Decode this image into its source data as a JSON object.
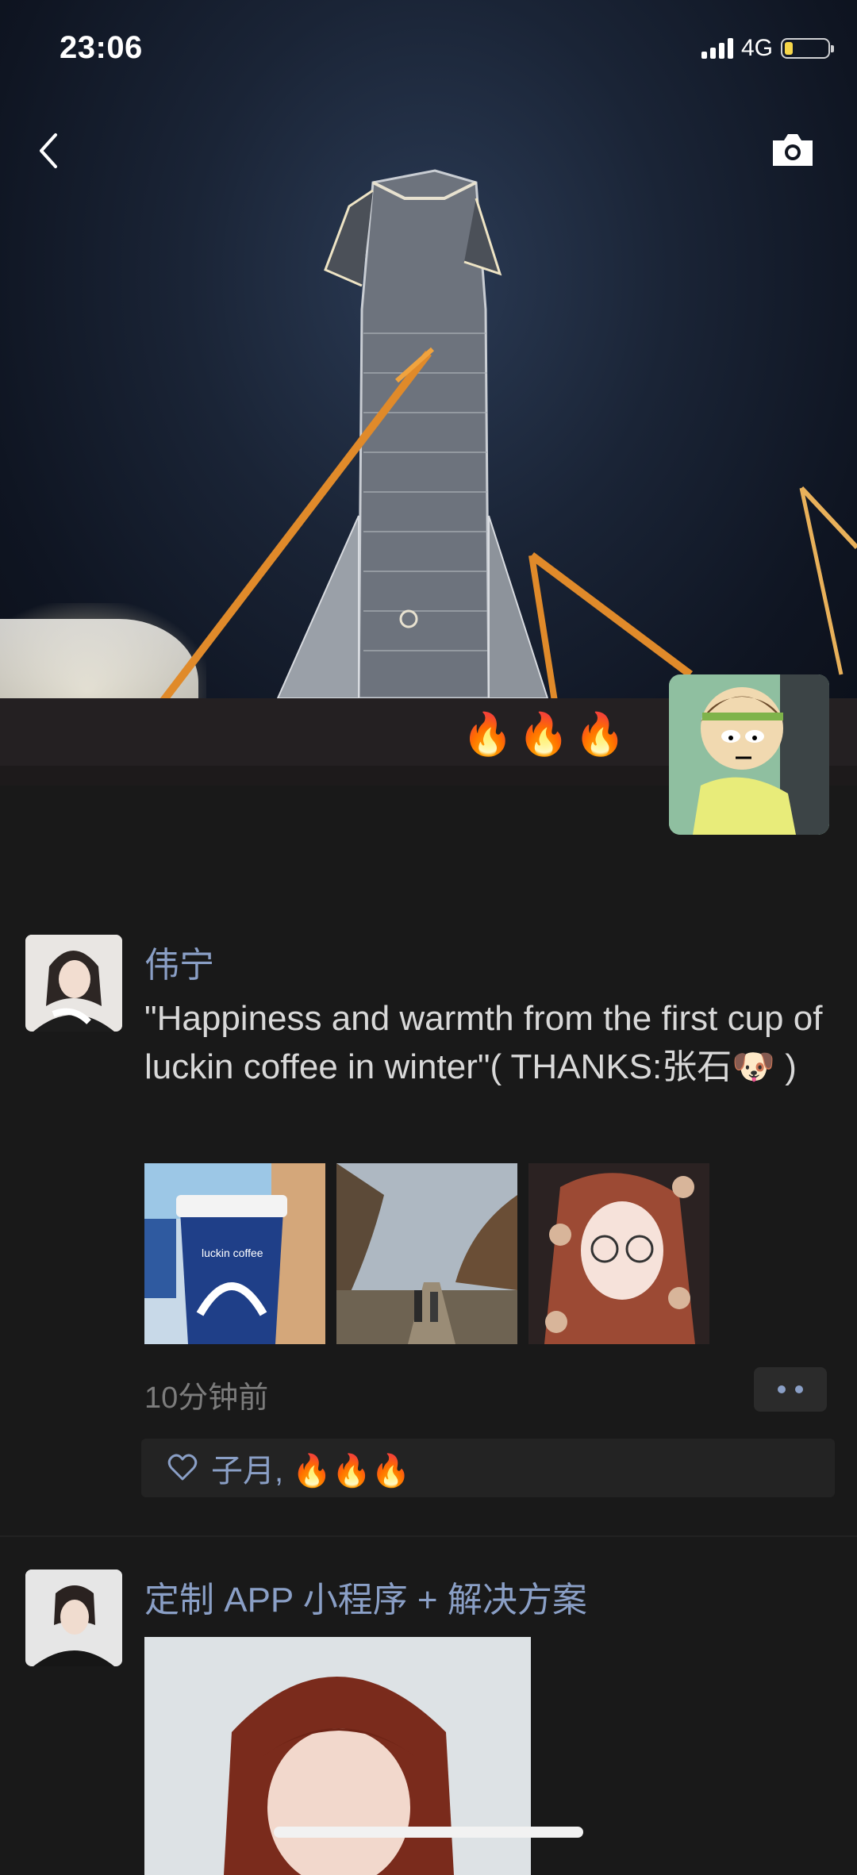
{
  "status_bar": {
    "time": "23:06",
    "network": "4G"
  },
  "cover": {
    "fire_emojis": "🔥🔥🔥"
  },
  "posts": [
    {
      "author": "伟宁",
      "text": "\"Happiness and warmth from the first cup of luckin coffee in winter\"( THANKS:张石🐶 )",
      "time": "10分钟前",
      "likes": "子月, 🔥🔥🔥"
    },
    {
      "author": "定制 APP 小程序 + 解决方案"
    }
  ],
  "photos": {
    "cup_label": "luckin coffee"
  },
  "colors": {
    "background": "#191919",
    "name_link": "#8a9fc6",
    "accent_fire": "#e08a2a"
  }
}
